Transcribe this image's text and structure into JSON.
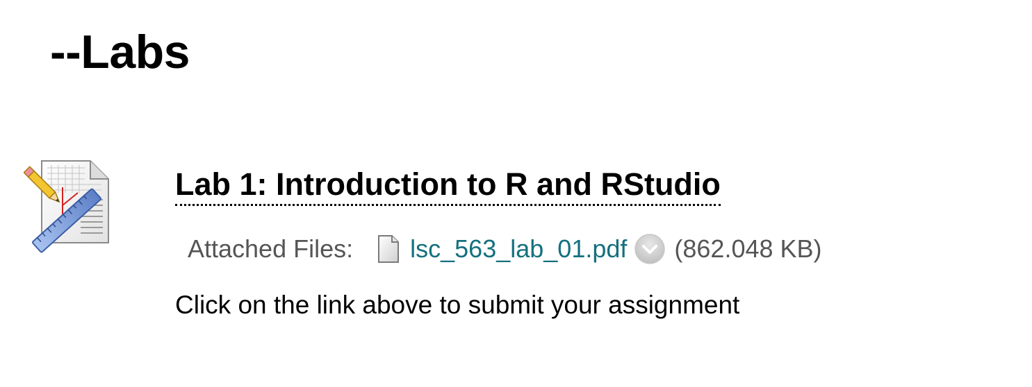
{
  "section": {
    "title": "--Labs"
  },
  "item": {
    "icon": "assignment-icon",
    "title": "Lab 1: Introduction to R and RStudio",
    "attached_files_label": "Attached Files:",
    "file": {
      "icon": "document-icon",
      "name": "lsc_563_lab_01.pdf",
      "menu_icon": "chevron-down-icon",
      "size": "(862.048 KB)"
    },
    "description": "Click on the link above to submit your assignment"
  },
  "colors": {
    "link": "#14707e",
    "muted_text": "#555555"
  }
}
